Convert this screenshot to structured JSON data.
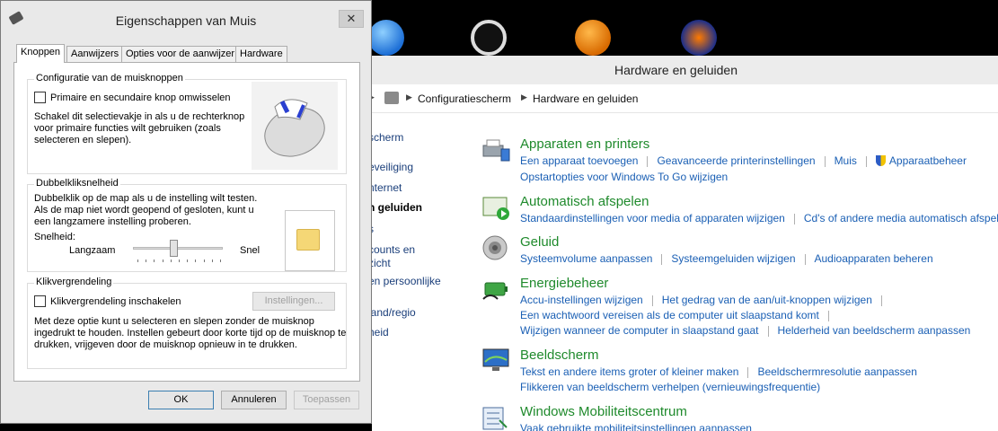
{
  "desktop": {
    "icons": [
      "itunes-icon",
      "box-app-icon",
      "fl-studio-icon",
      "audacity-icon"
    ]
  },
  "control_panel": {
    "title": "Hardware en geluiden",
    "breadcrumb": [
      "Configuratiescherm",
      "Hardware en geluiden"
    ],
    "nav": [
      "scherm",
      "eveiliging",
      "nternet",
      "n geluiden",
      "s",
      "counts en",
      "zicht",
      "en persoonlijke",
      "land/regio",
      "heid"
    ],
    "categories": [
      {
        "title": "Apparaten en printers",
        "icon": "printer-icon",
        "links": [
          [
            "Een apparaat toevoegen",
            "Geavanceerde printerinstellingen",
            "Muis",
            "Apparaatbeheer"
          ],
          [
            "Opstartopties voor Windows To Go wijzigen"
          ]
        ]
      },
      {
        "title": "Automatisch afspelen",
        "icon": "autoplay-icon",
        "links": [
          [
            "Standaardinstellingen voor media of apparaten wijzigen",
            "Cd's of andere media automatisch afspele"
          ]
        ]
      },
      {
        "title": "Geluid",
        "icon": "speaker-icon",
        "links": [
          [
            "Systeemvolume aanpassen",
            "Systeemgeluiden wijzigen",
            "Audioapparaten beheren"
          ]
        ]
      },
      {
        "title": "Energiebeheer",
        "icon": "battery-icon",
        "links": [
          [
            "Accu-instellingen wijzigen",
            "Het gedrag van de aan/uit-knoppen wijzigen"
          ],
          [
            "Een wachtwoord vereisen als de computer uit slaapstand komt"
          ],
          [
            "Wijzigen wanneer de computer in slaapstand gaat",
            "Helderheid van beeldscherm aanpassen"
          ]
        ]
      },
      {
        "title": "Beeldscherm",
        "icon": "monitor-icon",
        "links": [
          [
            "Tekst en andere items groter of kleiner maken",
            "Beeldschermresolutie aanpassen"
          ],
          [
            "Flikkeren van beeldscherm verhelpen (vernieuwingsfrequentie)"
          ]
        ]
      },
      {
        "title": "Windows Mobiliteitscentrum",
        "icon": "mobility-icon",
        "links": [
          [
            "Vaak gebruikte mobiliteitsinstellingen aanpassen"
          ]
        ]
      }
    ]
  },
  "dialog": {
    "title": "Eigenschappen van Muis",
    "close": "✕",
    "tabs": [
      "Knoppen",
      "Aanwijzers",
      "Opties voor de aanwijzer",
      "Hardware"
    ],
    "button_config": {
      "label": "Configuratie van de muisknoppen",
      "checkbox": "Primaire en secundaire knop omwisselen",
      "desc": [
        "Schakel dit selectievakje in als u de rechterknop",
        "voor primaire functies wilt gebruiken (zoals",
        "selecteren en slepen)."
      ]
    },
    "double_click": {
      "label": "Dubbelkliksnelheid",
      "desc": [
        "Dubbelklik op de map als u de instelling wilt testen.",
        "Als de map niet wordt geopend of gesloten, kunt u",
        "een langzamere instelling proberen."
      ],
      "speed_label": "Snelheid:",
      "slow": "Langzaam",
      "fast": "Snel",
      "speed_value": 0.45
    },
    "click_lock": {
      "label": "Klikvergrendeling",
      "checkbox": "Klikvergrendeling inschakelen",
      "settings_button": "Instellingen...",
      "desc": [
        "Met deze optie kunt u selecteren en slepen zonder de muisknop",
        "ingedrukt te houden. Instellen gebeurt door korte tijd op de muisknop te",
        "drukken, vrijgeven door de muisknop opnieuw in te drukken."
      ]
    },
    "buttons": {
      "ok": "OK",
      "cancel": "Annuleren",
      "apply": "Toepassen"
    }
  }
}
